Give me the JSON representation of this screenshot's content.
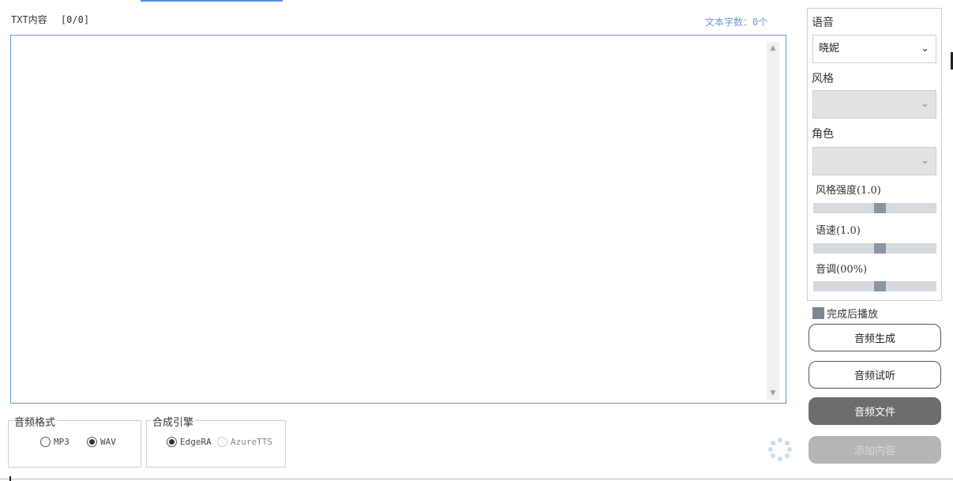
{
  "editor": {
    "label": "TXT内容",
    "line_count": "[0/0]",
    "word_count": "文本字数：0个"
  },
  "audio_format": {
    "title": "音频格式",
    "options": [
      {
        "label": "MP3",
        "checked": false
      },
      {
        "label": "WAV",
        "checked": true
      }
    ]
  },
  "engine": {
    "title": "合成引擎",
    "options": [
      {
        "label": "EdgeRA",
        "checked": true
      },
      {
        "label": "AzureTTS",
        "checked": false
      }
    ]
  },
  "settings": {
    "voice_label": "语音",
    "voice_value": "晓妮",
    "style_label": "风格",
    "style_value": "",
    "role_label": "角色",
    "role_value": "",
    "style_strength_label": "风格强度(1.0)",
    "style_strength_value": 1.0,
    "speed_label": "语速(1.0)",
    "speed_value": 1.0,
    "pitch_label": "音调(00%)",
    "pitch_value": 0
  },
  "play_after": {
    "label": "完成后播放",
    "checked": true
  },
  "buttons": {
    "generate": "音频生成",
    "preview": "音频试听",
    "file": "音频文件",
    "add": "添加内容"
  },
  "colors": {
    "accent": "#6b93d6",
    "word_count": "#6f96c8",
    "dark_button": "#6d6d6d",
    "disabled_button": "#b5b5b5"
  }
}
